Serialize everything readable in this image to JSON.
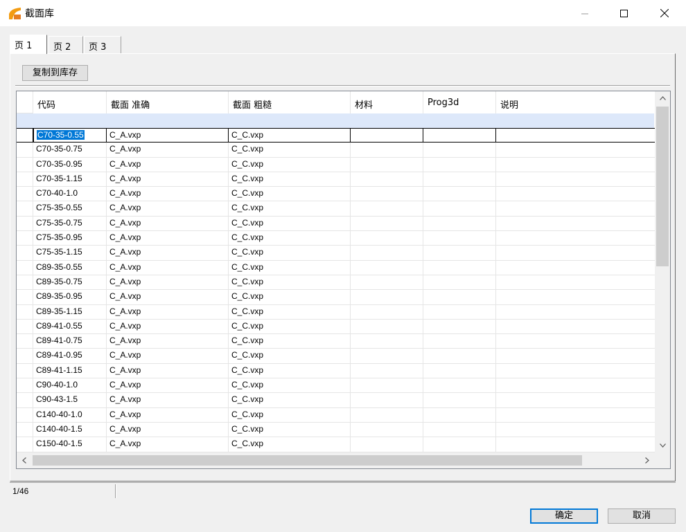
{
  "window": {
    "title": "截面库"
  },
  "tabs": [
    {
      "label": "页 1"
    },
    {
      "label": "页 2"
    },
    {
      "label": "页 3"
    }
  ],
  "toolbar": {
    "copy_label": "复制到库存"
  },
  "table": {
    "columns": [
      "代码",
      "截面 准确",
      "截面 粗糙",
      "材料",
      "Prog3d",
      "说明"
    ],
    "rows": [
      [
        "C70-35-0.55",
        "C_A.vxp",
        "C_C.vxp",
        "",
        "",
        ""
      ],
      [
        "C70-35-0.75",
        "C_A.vxp",
        "C_C.vxp",
        "",
        "",
        ""
      ],
      [
        "C70-35-0.95",
        "C_A.vxp",
        "C_C.vxp",
        "",
        "",
        ""
      ],
      [
        "C70-35-1.15",
        "C_A.vxp",
        "C_C.vxp",
        "",
        "",
        ""
      ],
      [
        "C70-40-1.0",
        "C_A.vxp",
        "C_C.vxp",
        "",
        "",
        ""
      ],
      [
        "C75-35-0.55",
        "C_A.vxp",
        "C_C.vxp",
        "",
        "",
        ""
      ],
      [
        "C75-35-0.75",
        "C_A.vxp",
        "C_C.vxp",
        "",
        "",
        ""
      ],
      [
        "C75-35-0.95",
        "C_A.vxp",
        "C_C.vxp",
        "",
        "",
        ""
      ],
      [
        "C75-35-1.15",
        "C_A.vxp",
        "C_C.vxp",
        "",
        "",
        ""
      ],
      [
        "C89-35-0.55",
        "C_A.vxp",
        "C_C.vxp",
        "",
        "",
        ""
      ],
      [
        "C89-35-0.75",
        "C_A.vxp",
        "C_C.vxp",
        "",
        "",
        ""
      ],
      [
        "C89-35-0.95",
        "C_A.vxp",
        "C_C.vxp",
        "",
        "",
        ""
      ],
      [
        "C89-35-1.15",
        "C_A.vxp",
        "C_C.vxp",
        "",
        "",
        ""
      ],
      [
        "C89-41-0.55",
        "C_A.vxp",
        "C_C.vxp",
        "",
        "",
        ""
      ],
      [
        "C89-41-0.75",
        "C_A.vxp",
        "C_C.vxp",
        "",
        "",
        ""
      ],
      [
        "C89-41-0.95",
        "C_A.vxp",
        "C_C.vxp",
        "",
        "",
        ""
      ],
      [
        "C89-41-1.15",
        "C_A.vxp",
        "C_C.vxp",
        "",
        "",
        ""
      ],
      [
        "C90-40-1.0",
        "C_A.vxp",
        "C_C.vxp",
        "",
        "",
        ""
      ],
      [
        "C90-43-1.5",
        "C_A.vxp",
        "C_C.vxp",
        "",
        "",
        ""
      ],
      [
        "C140-40-1.0",
        "C_A.vxp",
        "C_C.vxp",
        "",
        "",
        ""
      ],
      [
        "C140-40-1.5",
        "C_A.vxp",
        "C_C.vxp",
        "",
        "",
        ""
      ],
      [
        "C150-40-1.5",
        "C_A.vxp",
        "C_C.vxp",
        "",
        "",
        ""
      ]
    ],
    "selected_row": 0
  },
  "status": {
    "record_position": "1/46"
  },
  "buttons": {
    "ok": "确定",
    "cancel": "取消"
  },
  "colors": {
    "accent": "#0078d7",
    "new_row": "#dde8fa",
    "selection": "#0078d7"
  }
}
